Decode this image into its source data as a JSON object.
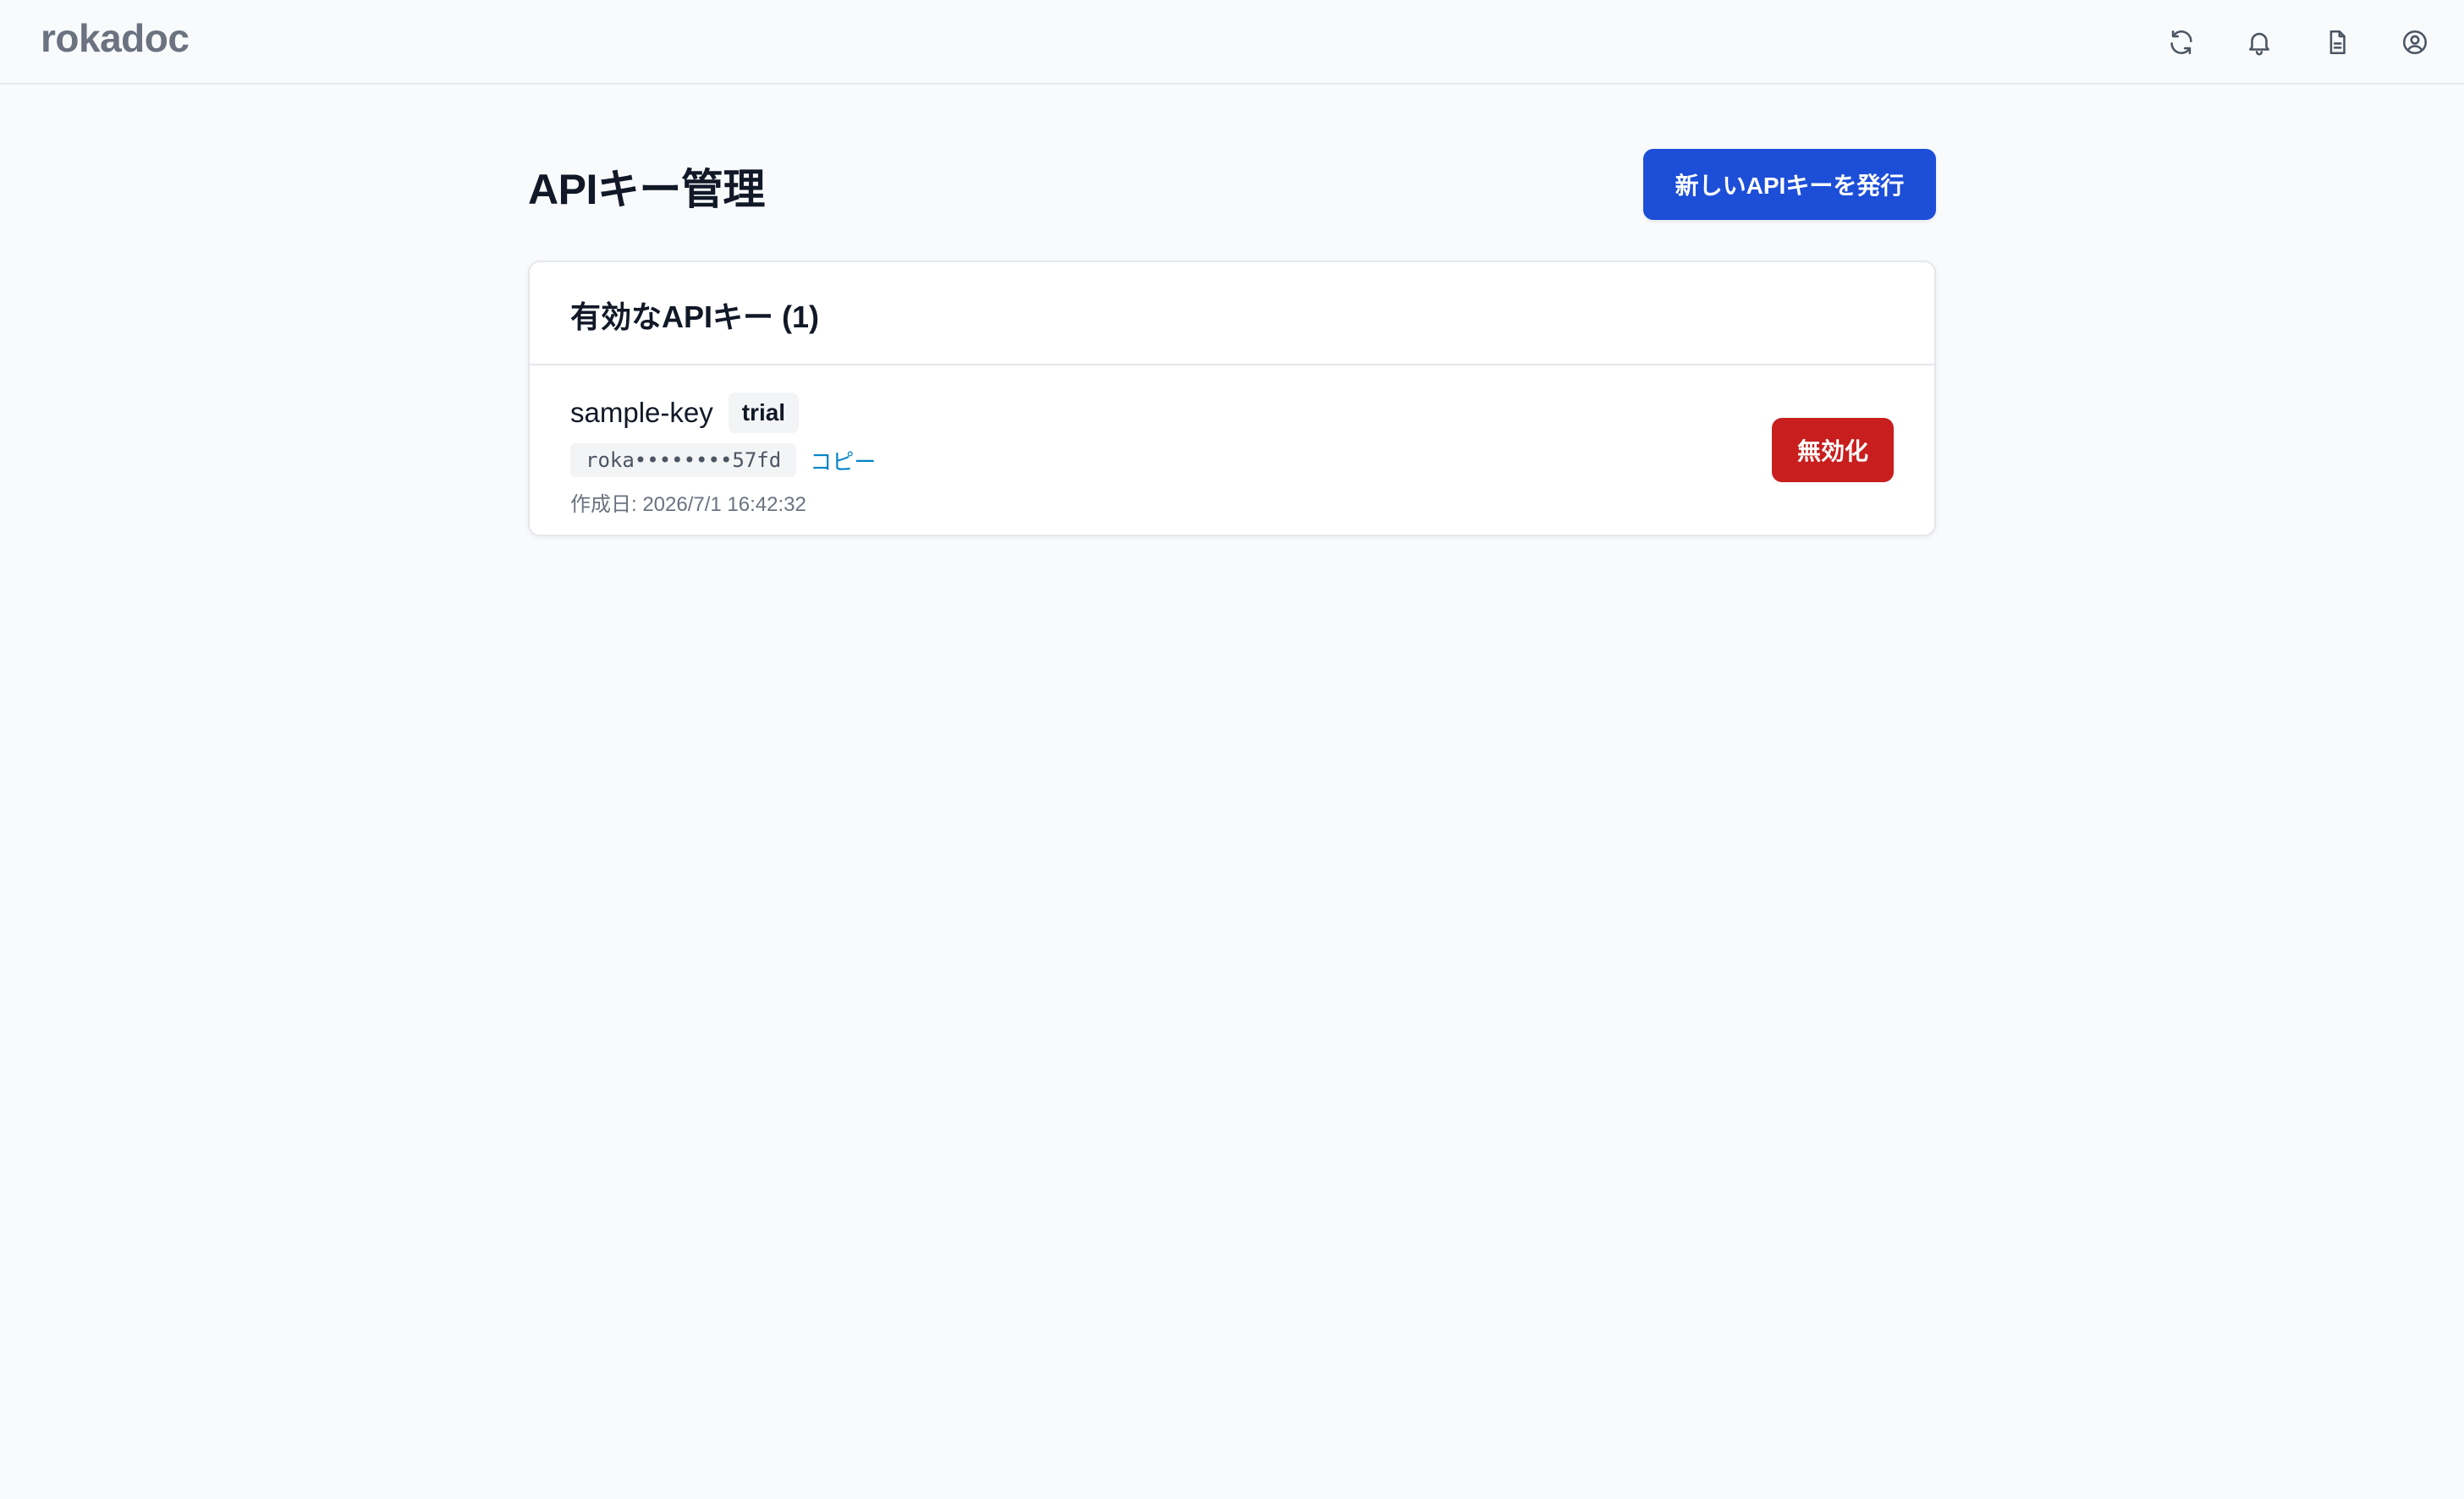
{
  "header": {
    "brand": "rokadoc",
    "icons": [
      "refresh-icon",
      "bell-icon",
      "document-icon",
      "user-circle-icon"
    ]
  },
  "page": {
    "title": "APIキー管理",
    "new_key_button": "新しいAPIキーを発行"
  },
  "active_keys": {
    "title": "有効なAPIキー (1)",
    "items": [
      {
        "name": "sample-key",
        "badge": "trial",
        "masked_key": "roka••••••••57fd",
        "copy_label": "コピー",
        "created_at": "作成日: 2026/7/1 16:42:32",
        "revoke_label": "無効化"
      }
    ]
  },
  "colors": {
    "primary": "#1d4ed8",
    "danger": "#c81e1e",
    "link": "#0284c7",
    "background": "#f8fafc"
  }
}
